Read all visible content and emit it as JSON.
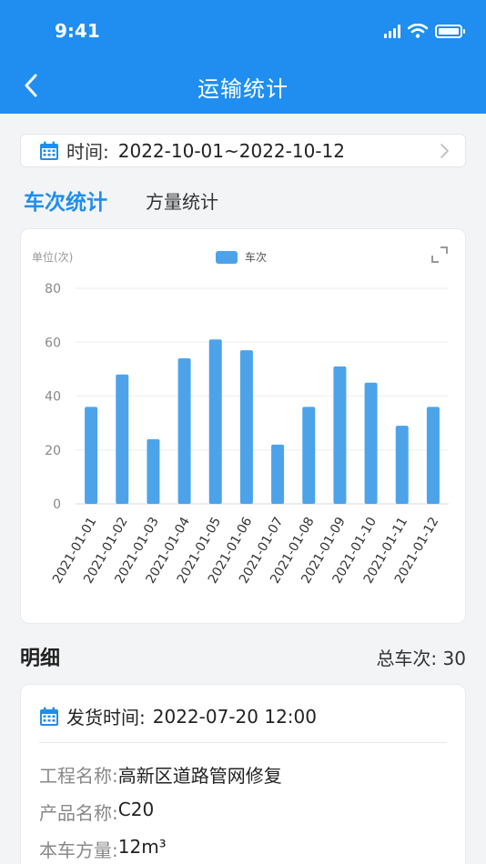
{
  "status_bar": {
    "time": "9:41"
  },
  "header": {
    "title": "运输统计"
  },
  "time_filter": {
    "label": "时间:",
    "value": "2022-10-01~2022-10-12"
  },
  "tabs": [
    {
      "label": "车次统计",
      "active": true
    },
    {
      "label": "方量统计",
      "active": false
    }
  ],
  "chart_data": {
    "type": "bar",
    "unit_label": "单位(次)",
    "legend": "车次",
    "categories": [
      "2021-01-01",
      "2021-01-02",
      "2021-01-03",
      "2021-01-04",
      "2021-01-05",
      "2021-01-06",
      "2021-01-07",
      "2021-01-08",
      "2021-01-09",
      "2021-01-10",
      "2021-01-11",
      "2021-01-12"
    ],
    "series": [
      {
        "name": "车次",
        "values": [
          36,
          48,
          24,
          54,
          61,
          57,
          22,
          36,
          51,
          45,
          29,
          36
        ]
      }
    ],
    "ylim": [
      0,
      80
    ],
    "yticks": [
      0,
      20,
      40,
      60,
      80
    ],
    "grid": true,
    "color": "#4da3ea"
  },
  "details": {
    "title": "明细",
    "total_label": "总车次:",
    "total_value": "30",
    "record": {
      "ship_time_label": "发货时间:",
      "ship_time_value": "2022-07-20 12:00",
      "project_label": "工程名称:",
      "project_value": "高新区道路管网修复",
      "product_label": "产品名称:",
      "product_value": "C20",
      "volume_label": "本车方量:",
      "volume_value": "12m³"
    }
  },
  "colors": {
    "primary": "#1f8ef0",
    "bar": "#4da3ea"
  },
  "icons": [
    "back-chevron-icon",
    "calendar-icon",
    "chevron-right-icon",
    "expand-icon",
    "signal-icon",
    "wifi-icon",
    "battery-icon"
  ]
}
